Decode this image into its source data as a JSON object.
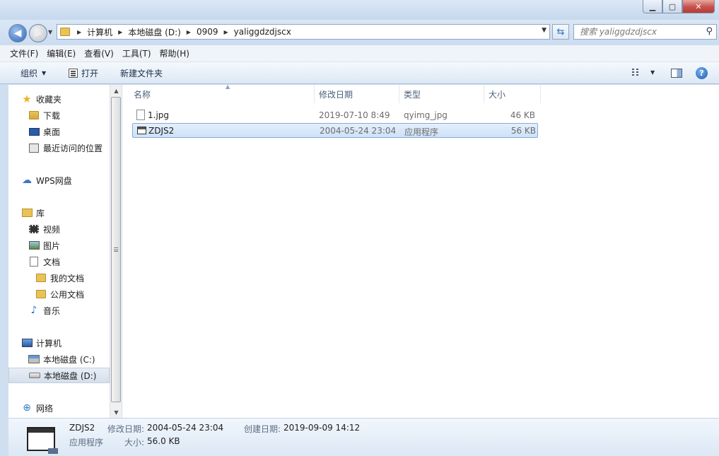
{
  "window": {
    "buttons": {
      "minimize": "▁",
      "maximize": "▢",
      "close": "✕"
    }
  },
  "address": {
    "crumbs": [
      "计算机",
      "本地磁盘 (D:)",
      "0909",
      "yaliggdzdjscx"
    ]
  },
  "search": {
    "placeholder": "搜索 yaliggdzdjscx"
  },
  "menubar": {
    "items": [
      "文件(F)",
      "编辑(E)",
      "查看(V)",
      "工具(T)",
      "帮助(H)"
    ]
  },
  "toolbar": {
    "organize": "组织",
    "open": "打开",
    "new_folder": "新建文件夹"
  },
  "nav": {
    "items": [
      {
        "label": "收藏夹",
        "icon": "star-icon"
      },
      {
        "label": "下载",
        "icon": "downloads-folder-icon"
      },
      {
        "label": "桌面",
        "icon": "desktop-icon"
      },
      {
        "label": "最近访问的位置",
        "icon": "recent-places-icon"
      },
      {
        "label": "WPS网盘",
        "icon": "cloud-icon"
      },
      {
        "label": "库",
        "icon": "library-icon"
      },
      {
        "label": "视频",
        "icon": "video-icon"
      },
      {
        "label": "图片",
        "icon": "pictures-icon"
      },
      {
        "label": "文档",
        "icon": "documents-icon"
      },
      {
        "label": "我的文档",
        "icon": "folder-icon"
      },
      {
        "label": "公用文档",
        "icon": "folder-icon"
      },
      {
        "label": "音乐",
        "icon": "music-icon"
      },
      {
        "label": "计算机",
        "icon": "computer-icon"
      },
      {
        "label": "本地磁盘 (C:)",
        "icon": "system-drive-icon"
      },
      {
        "label": "本地磁盘 (D:)",
        "icon": "drive-icon"
      },
      {
        "label": "网络",
        "icon": "network-icon"
      }
    ]
  },
  "columns": {
    "name": "名称",
    "date": "修改日期",
    "type": "类型",
    "size": "大小"
  },
  "files": [
    {
      "name": "1.jpg",
      "date": "2019-07-10 8:49",
      "type": "qyimg_jpg",
      "size": "46 KB"
    },
    {
      "name": "ZDJS2",
      "date": "2004-05-24 23:04",
      "type": "应用程序",
      "size": "56 KB"
    }
  ],
  "details": {
    "name": "ZDJS2",
    "kind": "应用程序",
    "modified_label": "修改日期:",
    "modified": "2004-05-24 23:04",
    "created_label": "创建日期:",
    "created": "2019-09-09 14:12",
    "size_label": "大小:",
    "size": "56.0 KB"
  }
}
